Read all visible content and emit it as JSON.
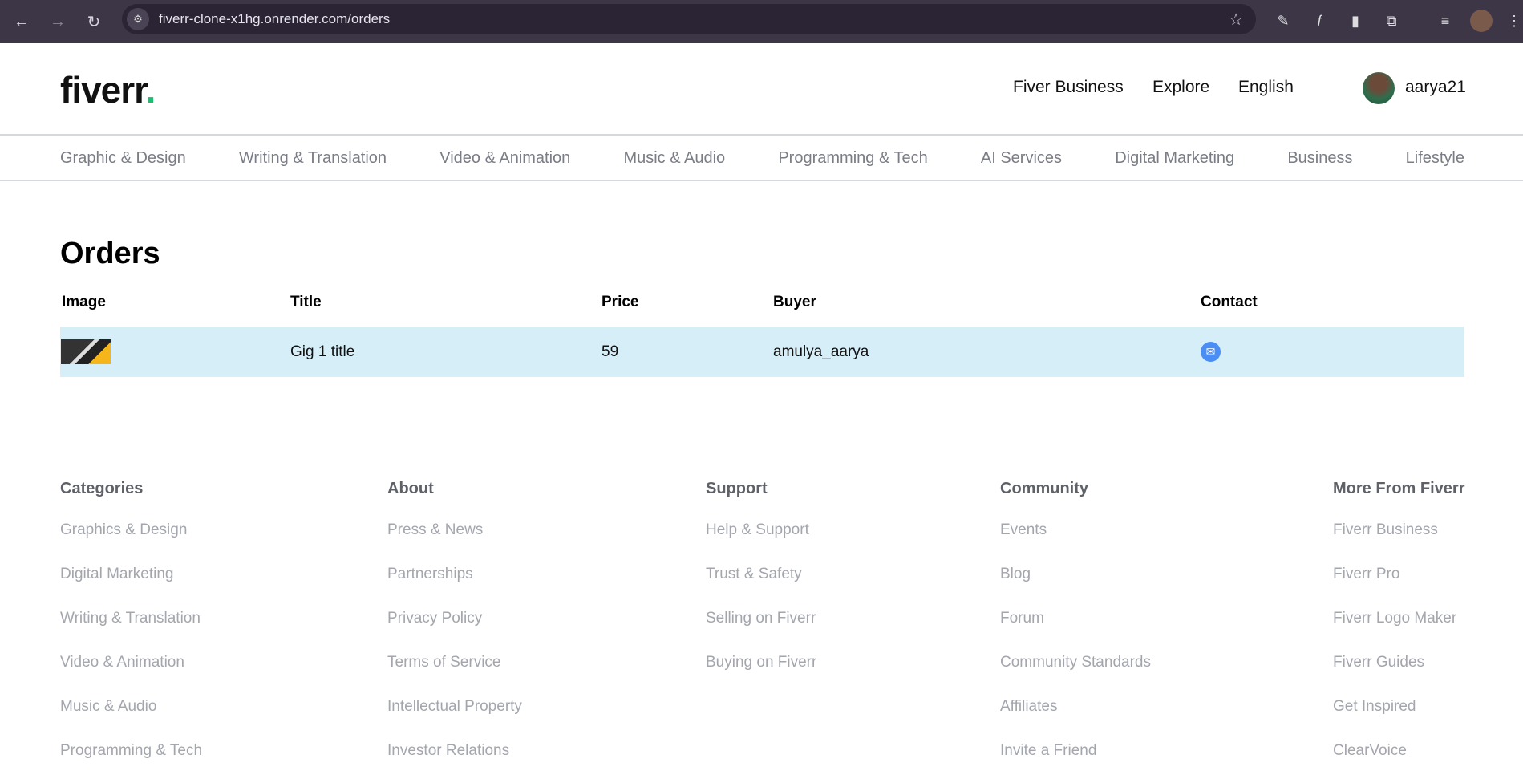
{
  "browser": {
    "url": "fiverr-clone-x1hg.onrender.com/orders"
  },
  "header": {
    "logo": "fiverr",
    "logo_dot": ".",
    "links": [
      "Fiver Business",
      "Explore",
      "English"
    ],
    "username": "aarya21"
  },
  "categories": [
    "Graphic & Design",
    "Writing & Translation",
    "Video & Animation",
    "Music & Audio",
    "Programming & Tech",
    "AI Services",
    "Digital Marketing",
    "Business",
    "Lifestyle"
  ],
  "orders": {
    "title": "Orders",
    "columns": [
      "Image",
      "Title",
      "Price",
      "Buyer",
      "Contact"
    ],
    "rows": [
      {
        "title": "Gig 1 title",
        "price": "59",
        "buyer": "amulya_aarya"
      }
    ]
  },
  "footer": [
    {
      "heading": "Categories",
      "items": [
        "Graphics & Design",
        "Digital Marketing",
        "Writing & Translation",
        "Video & Animation",
        "Music & Audio",
        "Programming & Tech"
      ]
    },
    {
      "heading": "About",
      "items": [
        "Press & News",
        "Partnerships",
        "Privacy Policy",
        "Terms of Service",
        "Intellectual Property",
        "Investor Relations"
      ]
    },
    {
      "heading": "Support",
      "items": [
        "Help & Support",
        "Trust & Safety",
        "Selling on Fiverr",
        "Buying on Fiverr"
      ]
    },
    {
      "heading": "Community",
      "items": [
        "Events",
        "Blog",
        "Forum",
        "Community Standards",
        "Affiliates",
        "Invite a Friend"
      ]
    },
    {
      "heading": "More From Fiverr",
      "items": [
        "Fiverr Business",
        "Fiverr Pro",
        "Fiverr Logo Maker",
        "Fiverr Guides",
        "Get Inspired",
        "ClearVoice"
      ]
    }
  ],
  "colors": {
    "brand_green": "#1dbf73",
    "row_highlight": "#d6eef8",
    "contact_blue": "#4a8df5"
  }
}
